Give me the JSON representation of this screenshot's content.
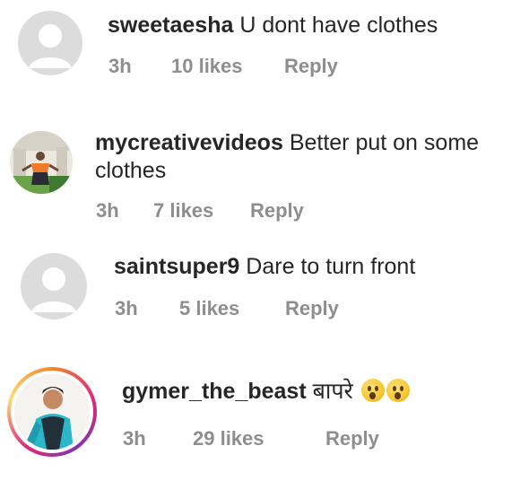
{
  "comments": [
    {
      "username": "sweetaesha",
      "text": "U dont have clothes",
      "time": "3h",
      "likes": "10 likes",
      "reply": "Reply",
      "avatar_icon": "default-avatar-icon"
    },
    {
      "username": "mycreativevideos",
      "text": "Better put on some clothes",
      "time": "3h",
      "likes": "7 likes",
      "reply": "Reply",
      "avatar_icon": "profile-photo"
    },
    {
      "username": "saintsuper9",
      "text": "Dare to turn front",
      "time": "3h",
      "likes": "5 likes",
      "reply": "Reply",
      "avatar_icon": "default-avatar-icon"
    },
    {
      "username": "gymer_the_beast",
      "text": "बापरे",
      "emoji": "hushed-face-emoji",
      "time": "3h",
      "likes": "29 likes",
      "reply": "Reply",
      "avatar_icon": "profile-photo-story-ring"
    }
  ],
  "colors": {
    "username": "#262626",
    "meta": "#8e8e8e",
    "default_avatar": "#dcdcdc"
  }
}
